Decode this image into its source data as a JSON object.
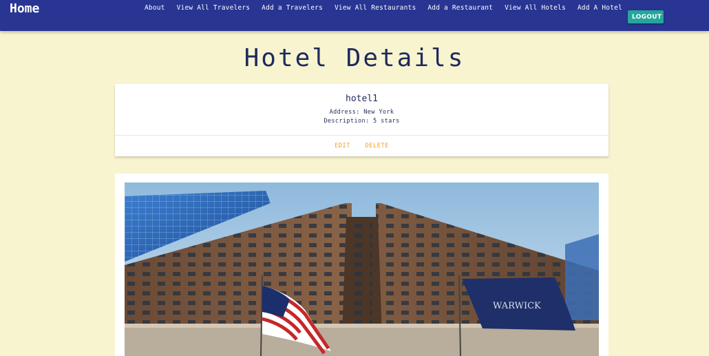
{
  "navbar": {
    "brand": "Home",
    "links": [
      "About",
      "View All Travelers",
      "Add a Travelers",
      "View All Restaurants",
      "Add a Restaurant",
      "View All Hotels",
      "Add A Hotel"
    ],
    "logout_label": "LOGOUT",
    "color": "#283593"
  },
  "page": {
    "title": "Hotel Details",
    "background": "#f7f4cf"
  },
  "hotel": {
    "name": "hotel1",
    "address": "Address: New York",
    "description": "Description: 5 stars"
  },
  "actions": {
    "edit_label": "EDIT",
    "delete_label": "DELETE",
    "color": "#f0a02a"
  },
  "image": {
    "subject": "hotel-building-photo",
    "flag_text": "WARWICK"
  }
}
